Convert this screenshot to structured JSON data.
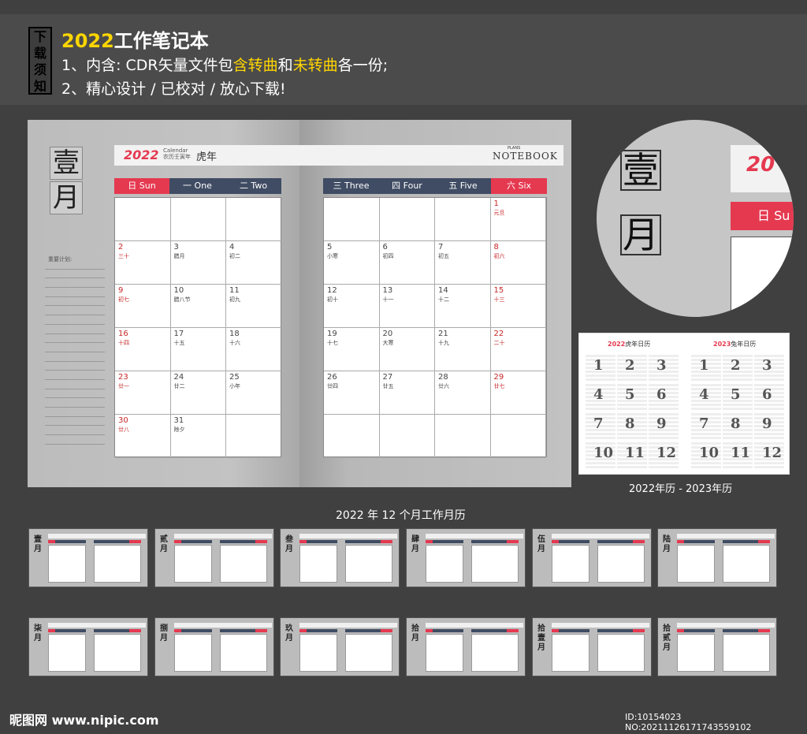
{
  "header": {
    "notice_label": [
      "下",
      "载",
      "须",
      "知"
    ],
    "title_year": "2022",
    "title_rest": "工作笔记本",
    "line1_a": "1、内含: CDR矢量文件包",
    "line1_b": "含转曲",
    "line1_c": "和",
    "line1_d": "未转曲",
    "line1_e": "各一份;",
    "line2": "2、精心设计 / 已校对 / 放心下载!"
  },
  "spread": {
    "year_brand": "2022",
    "calendar_small": "Calendar",
    "lunar_year_small": "农历壬寅年",
    "zodiac": "虎年",
    "notebook_plans": "PLANS",
    "notebook_word": "NOTEBOOK",
    "month_chars": [
      "壹",
      "月"
    ],
    "notes_label": "重要计划:",
    "weekdays": [
      {
        "label": "日 Sun",
        "color": "#e53950"
      },
      {
        "label": "一 One",
        "color": "#3f4c63"
      },
      {
        "label": "二 Two",
        "color": "#3f4c63"
      },
      {
        "label": "三 Three",
        "color": "#3f4c63"
      },
      {
        "label": "四 Four",
        "color": "#3f4c63"
      },
      {
        "label": "五 Five",
        "color": "#3f4c63"
      },
      {
        "label": "六 Six",
        "color": "#e53950"
      }
    ],
    "weeks": [
      [
        null,
        null,
        null,
        null,
        null,
        null,
        {
          "d": "1",
          "l": "元旦",
          "red": true
        }
      ],
      [
        {
          "d": "2",
          "l": "三十",
          "red": true
        },
        {
          "d": "3",
          "l": "腊月"
        },
        {
          "d": "4",
          "l": "初二"
        },
        {
          "d": "5",
          "l": "小寒"
        },
        {
          "d": "6",
          "l": "初四"
        },
        {
          "d": "7",
          "l": "初五"
        },
        {
          "d": "8",
          "l": "初六",
          "red": true
        }
      ],
      [
        {
          "d": "9",
          "l": "初七",
          "red": true
        },
        {
          "d": "10",
          "l": "腊八节"
        },
        {
          "d": "11",
          "l": "初九"
        },
        {
          "d": "12",
          "l": "初十"
        },
        {
          "d": "13",
          "l": "十一"
        },
        {
          "d": "14",
          "l": "十二"
        },
        {
          "d": "15",
          "l": "十三",
          "red": true
        }
      ],
      [
        {
          "d": "16",
          "l": "十四",
          "red": true
        },
        {
          "d": "17",
          "l": "十五"
        },
        {
          "d": "18",
          "l": "十六"
        },
        {
          "d": "19",
          "l": "十七"
        },
        {
          "d": "20",
          "l": "大寒"
        },
        {
          "d": "21",
          "l": "十九"
        },
        {
          "d": "22",
          "l": "二十",
          "red": true
        }
      ],
      [
        {
          "d": "23",
          "l": "廿一",
          "red": true
        },
        {
          "d": "24",
          "l": "廿二"
        },
        {
          "d": "25",
          "l": "小年"
        },
        {
          "d": "26",
          "l": "廿四"
        },
        {
          "d": "27",
          "l": "廿五"
        },
        {
          "d": "28",
          "l": "廿六"
        },
        {
          "d": "29",
          "l": "廿七",
          "red": true
        }
      ],
      [
        {
          "d": "30",
          "l": "廿八",
          "red": true
        },
        {
          "d": "31",
          "l": "除夕"
        },
        null,
        null,
        null,
        null,
        null
      ]
    ]
  },
  "zoom": {
    "chars": [
      "壹",
      "月"
    ],
    "year": "20",
    "weekday": "日 Su"
  },
  "mini_calendar": {
    "left_year": "2022",
    "left_title": "虎年日历",
    "right_year": "2023",
    "right_title": "兔年日历",
    "months": [
      "1",
      "2",
      "3",
      "4",
      "5",
      "6",
      "7",
      "8",
      "9",
      "10",
      "11",
      "12"
    ],
    "caption": "2022年历 - 2023年历"
  },
  "section_title": "2022 年 12 个月工作月历",
  "thumbnails": [
    {
      "name": "壹月"
    },
    {
      "name": "贰月"
    },
    {
      "name": "叁月"
    },
    {
      "name": "肆月"
    },
    {
      "name": "伍月"
    },
    {
      "name": "陆月"
    },
    {
      "name": "柒月"
    },
    {
      "name": "捌月"
    },
    {
      "name": "玖月"
    },
    {
      "name": "拾月"
    },
    {
      "name": "拾壹月"
    },
    {
      "name": "拾贰月"
    }
  ],
  "footer": {
    "logo": "昵图网 www.nipic.com",
    "id": "ID:10154023 NO:20211126171743559102"
  },
  "colors": {
    "accent_red": "#e53950",
    "navy": "#3f4c63",
    "yellow": "#ffd600"
  }
}
